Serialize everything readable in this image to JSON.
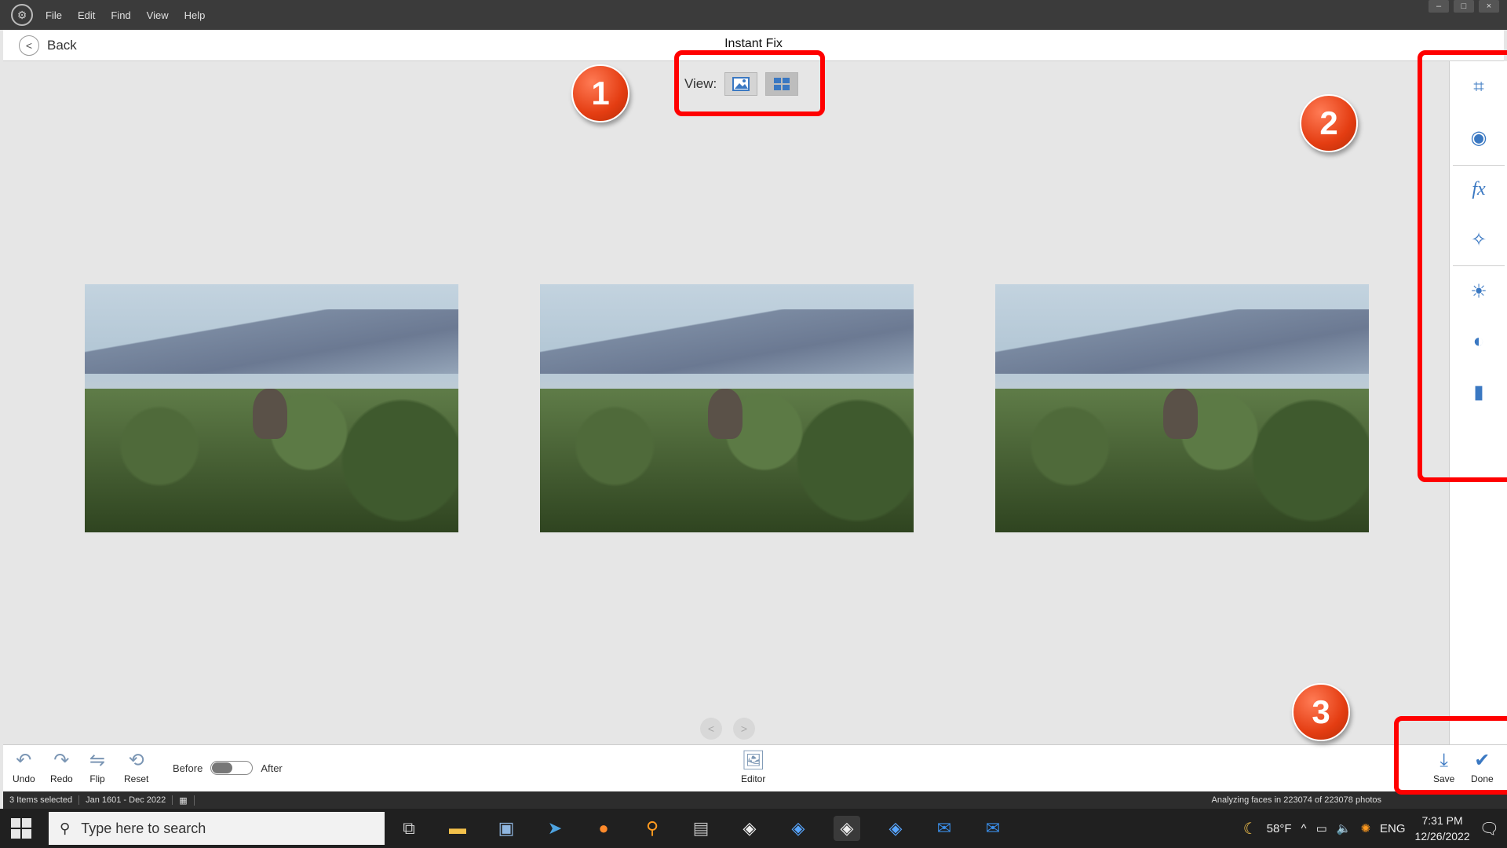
{
  "menubar": {
    "menu": [
      "File",
      "Edit",
      "Find",
      "View",
      "Help"
    ],
    "window_controls": [
      "–",
      "□",
      "×"
    ]
  },
  "header": {
    "back_label": "Back",
    "title": "Instant Fix"
  },
  "view": {
    "label": "View:",
    "modes": [
      {
        "name": "single-photo-view",
        "icon": "image-icon"
      },
      {
        "name": "grid-view",
        "icon": "grid-icon",
        "active": true
      }
    ]
  },
  "photos": [
    {
      "name": "photo-1"
    },
    {
      "name": "photo-2"
    },
    {
      "name": "photo-3"
    }
  ],
  "pager": {
    "prev": "<",
    "next": ">"
  },
  "tools": [
    {
      "name": "crop-tool",
      "icon": "crop-icon",
      "glyph": "⌗"
    },
    {
      "name": "red-eye-tool",
      "icon": "eye-icon",
      "glyph": "◉"
    },
    {
      "name": "effects-tool",
      "icon": "fx-icon",
      "glyph": "fx"
    },
    {
      "name": "smart-fix-tool",
      "icon": "magic-wand-icon",
      "glyph": "✧"
    },
    {
      "name": "light-tool",
      "icon": "sun-icon",
      "glyph": "☀"
    },
    {
      "name": "color-tool",
      "icon": "palette-icon",
      "glyph": "◐"
    },
    {
      "name": "clarity-tool",
      "icon": "book-icon",
      "glyph": "▮"
    }
  ],
  "bottombar": {
    "undo": "Undo",
    "redo": "Redo",
    "flip": "Flip",
    "reset": "Reset",
    "before": "Before",
    "after": "After",
    "editor": "Editor",
    "save": "Save",
    "done": "Done"
  },
  "status": {
    "selected": "3 Items selected",
    "date_range": "Jan 1601 - Dec 2022",
    "analyzing": "Analyzing faces in 223074 of 223078 photos"
  },
  "taskbar": {
    "search_placeholder": "Type here to search",
    "weather": "58°F",
    "language": "ENG",
    "time": "7:31 PM",
    "date": "12/26/2022"
  },
  "annotations": {
    "callout_1": "1",
    "callout_2": "2",
    "callout_3": "3"
  },
  "colors": {
    "accent": "#3a78c2",
    "highlight": "#ff0000"
  }
}
